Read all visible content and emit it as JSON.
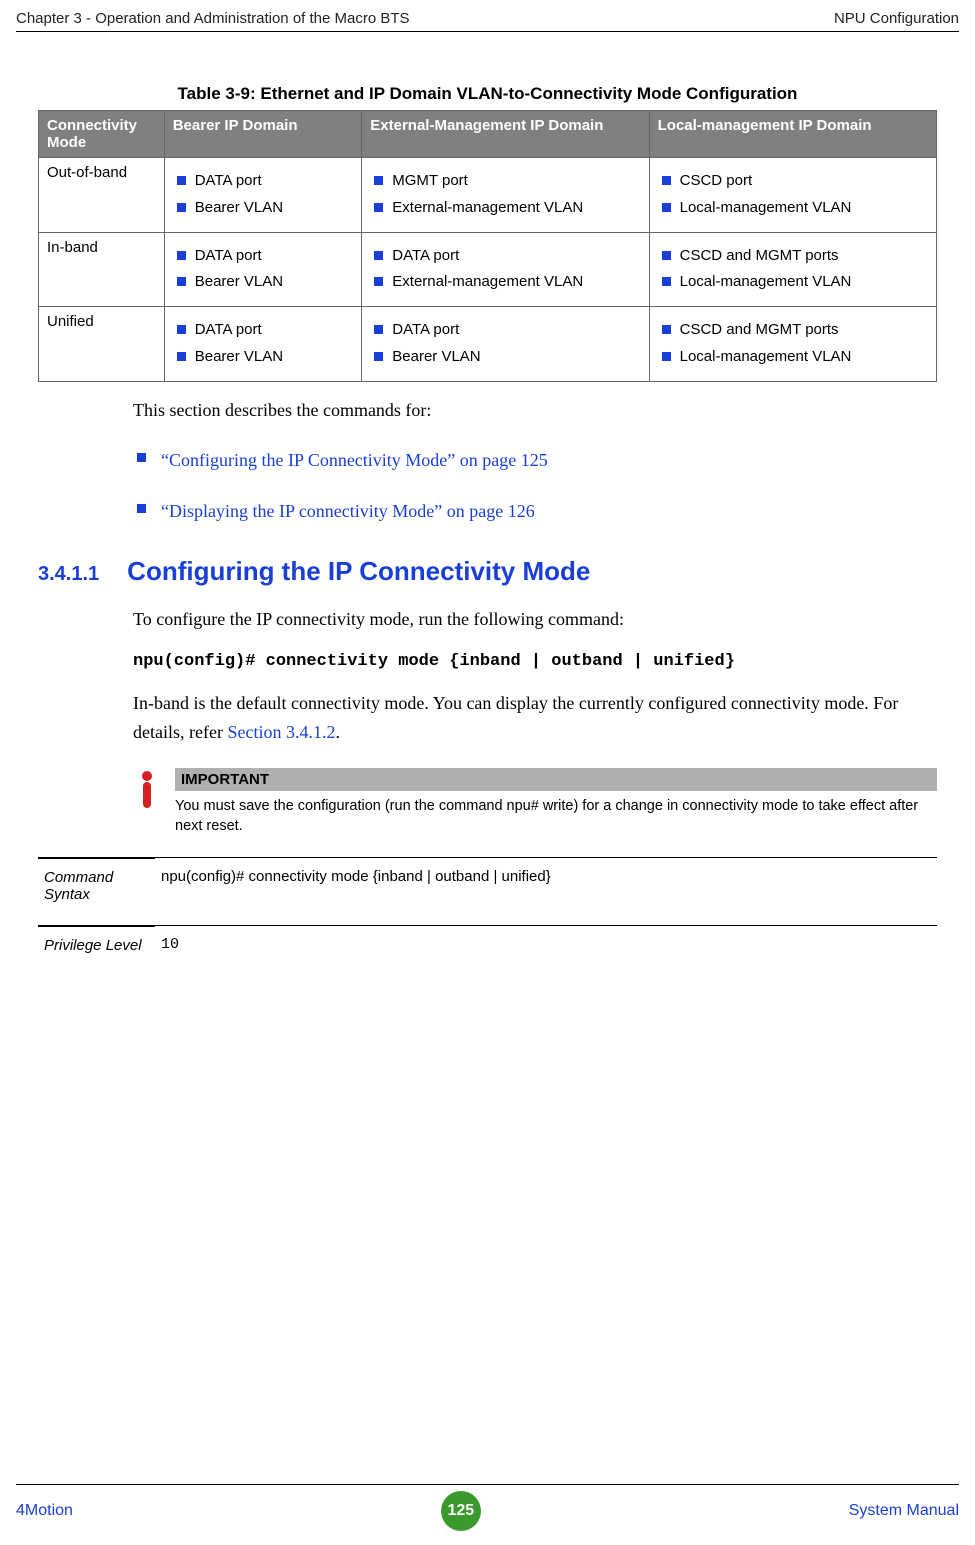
{
  "header": {
    "left": "Chapter 3 - Operation and Administration of the Macro BTS",
    "right": "NPU Configuration"
  },
  "table": {
    "caption": "Table 3-9: Ethernet and IP Domain VLAN-to-Connectivity Mode Configuration",
    "headers": {
      "c1": "Connectivity Mode",
      "c2": "Bearer IP Domain",
      "c3": "External-Management IP Domain",
      "c4": "Local-management IP Domain"
    },
    "rows": [
      {
        "mode": "Out-of-band",
        "c2": [
          "DATA port",
          "Bearer VLAN"
        ],
        "c3": [
          "MGMT port",
          "External-management VLAN"
        ],
        "c4": [
          "CSCD port",
          "Local-management VLAN"
        ]
      },
      {
        "mode": "In-band",
        "c2": [
          "DATA port",
          "Bearer VLAN"
        ],
        "c3": [
          "DATA port",
          "External-management VLAN"
        ],
        "c4": [
          "CSCD and MGMT ports",
          "Local-management VLAN"
        ]
      },
      {
        "mode": "Unified",
        "c2": [
          "DATA port",
          "Bearer VLAN"
        ],
        "c3": [
          "DATA port",
          "Bearer VLAN"
        ],
        "c4": [
          "CSCD and MGMT ports",
          "Local-management VLAN"
        ]
      }
    ]
  },
  "intro": "This section describes the commands for:",
  "xrefs": [
    "“Configuring the IP Connectivity Mode” on page 125",
    "“Displaying the IP connectivity Mode” on page 126"
  ],
  "section": {
    "num": "3.4.1.1",
    "title": "Configuring the IP Connectivity Mode"
  },
  "para1": "To configure the IP connectivity mode, run the following command:",
  "command": "npu(config)# connectivity mode {inband | outband | unified}",
  "para2a": "In-band is the default connectivity mode. You can display the currently configured connectivity mode. For details, refer ",
  "para2b": "Section 3.4.1.2",
  "para2c": ".",
  "important": {
    "title": "IMPORTANT",
    "text": "You must save the configuration (run the command npu# write) for a change in connectivity mode to take effect after next reset."
  },
  "cmd": {
    "label1": "Command Syntax",
    "value1": "npu(config)# connectivity mode {inband | outband | unified}",
    "label2": "Privilege Level",
    "value2": "10"
  },
  "footer": {
    "left": "4Motion",
    "page": "125",
    "right": "System Manual"
  }
}
